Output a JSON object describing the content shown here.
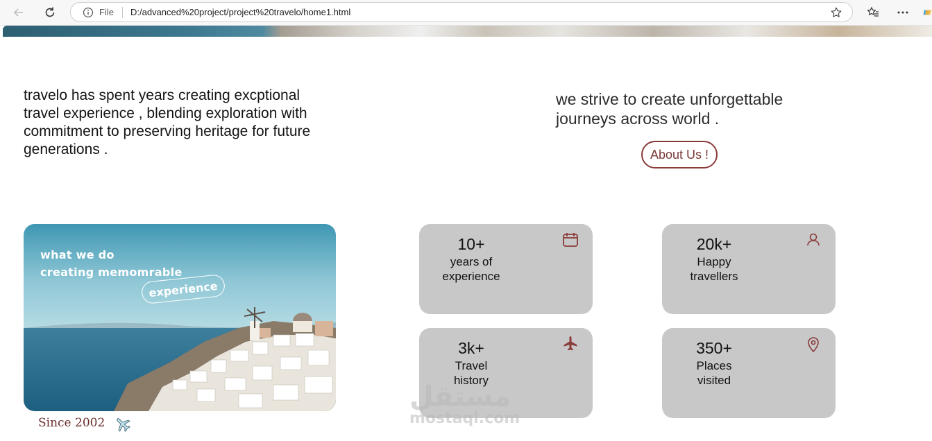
{
  "browser": {
    "scheme_label": "File",
    "url": "D:/advanced%20project/project%20travelo/home1.html",
    "icons": [
      "back-icon",
      "reload-icon",
      "info-icon",
      "star-icon",
      "favorites-icon",
      "more-icon",
      "copilot-icon"
    ]
  },
  "intro": {
    "text": "travelo has spent years creating excptional travel experience , blending exploration with commitment to preserving heritage for future generations ."
  },
  "mission": {
    "text": "we strive to create unforgettable journeys across world .",
    "button_label": "About Us !"
  },
  "photo": {
    "caption_line1": "what we do",
    "caption_line2": "creating memomrable",
    "caption_pill": "experience"
  },
  "since_label": "Since 2002",
  "stats": [
    {
      "value": "10+",
      "label_line1": "years of",
      "label_line2": "experience",
      "icon": "calendar-icon"
    },
    {
      "value": "20k+",
      "label_line1": "Happy",
      "label_line2": "travellers",
      "icon": "user-icon"
    },
    {
      "value": "3k+",
      "label_line1": "Travel",
      "label_line2": "history",
      "icon": "airplane-icon"
    },
    {
      "value": "350+",
      "label_line1": "Places",
      "label_line2": "visited",
      "icon": "location-pin-icon"
    }
  ],
  "watermark": {
    "line1": "مستقل",
    "line2": "mostaql.com"
  },
  "colors": {
    "accent": "#7a3a38",
    "card_bg": "#c8c8c8",
    "sea": "#2a6f8c"
  }
}
